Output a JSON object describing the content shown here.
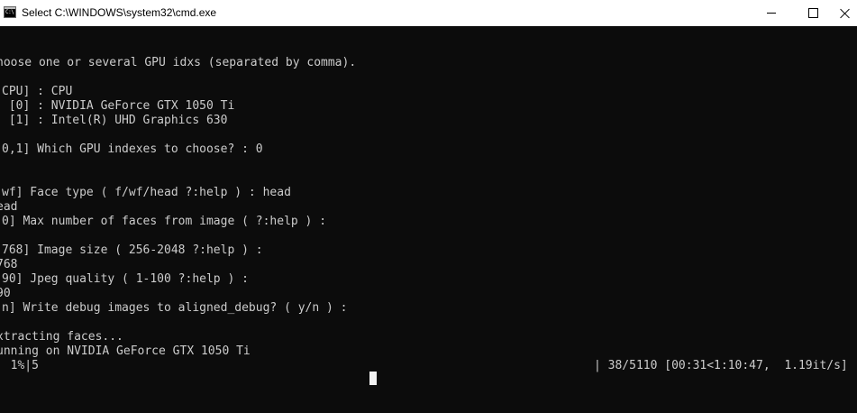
{
  "window": {
    "title": "Select C:\\WINDOWS\\system32\\cmd.exe",
    "icon": "cmd-app-icon",
    "icon_glyph": "C:\\"
  },
  "controls": {
    "minimize": "minimize-icon",
    "maximize": "maximize-icon",
    "close": "close-icon"
  },
  "console": {
    "text_color": "#cccccc",
    "background": "#0c0c0c",
    "lines": [
      "hoose one or several GPU idxs (separated by comma).",
      "CPU] : CPU",
      " [0] : NVIDIA GeForce GTX 1050 Ti",
      " [1] : Intel(R) UHD Graphics 630",
      "0,1] Which GPU indexes to choose? : 0",
      "",
      "wf] Face type ( f/wf/head ?:help ) : head",
      "ead",
      "0] Max number of faces from image ( ?:help ) :",
      "",
      "768] Image size ( 256-2048 ?:help ) :",
      "768",
      "90] Jpeg quality ( 1-100 ?:help ) :",
      "90",
      "n] Write debug images to aligned_debug? ( y/n ) :",
      "",
      "xtracting faces...",
      "unning on NVIDIA GeForce GTX 1050 Ti"
    ],
    "progress": {
      "percent_label": "  1%|5",
      "stats_label": "| 38/5110 [00:31<1:10:47,  1.19it/s]"
    }
  }
}
